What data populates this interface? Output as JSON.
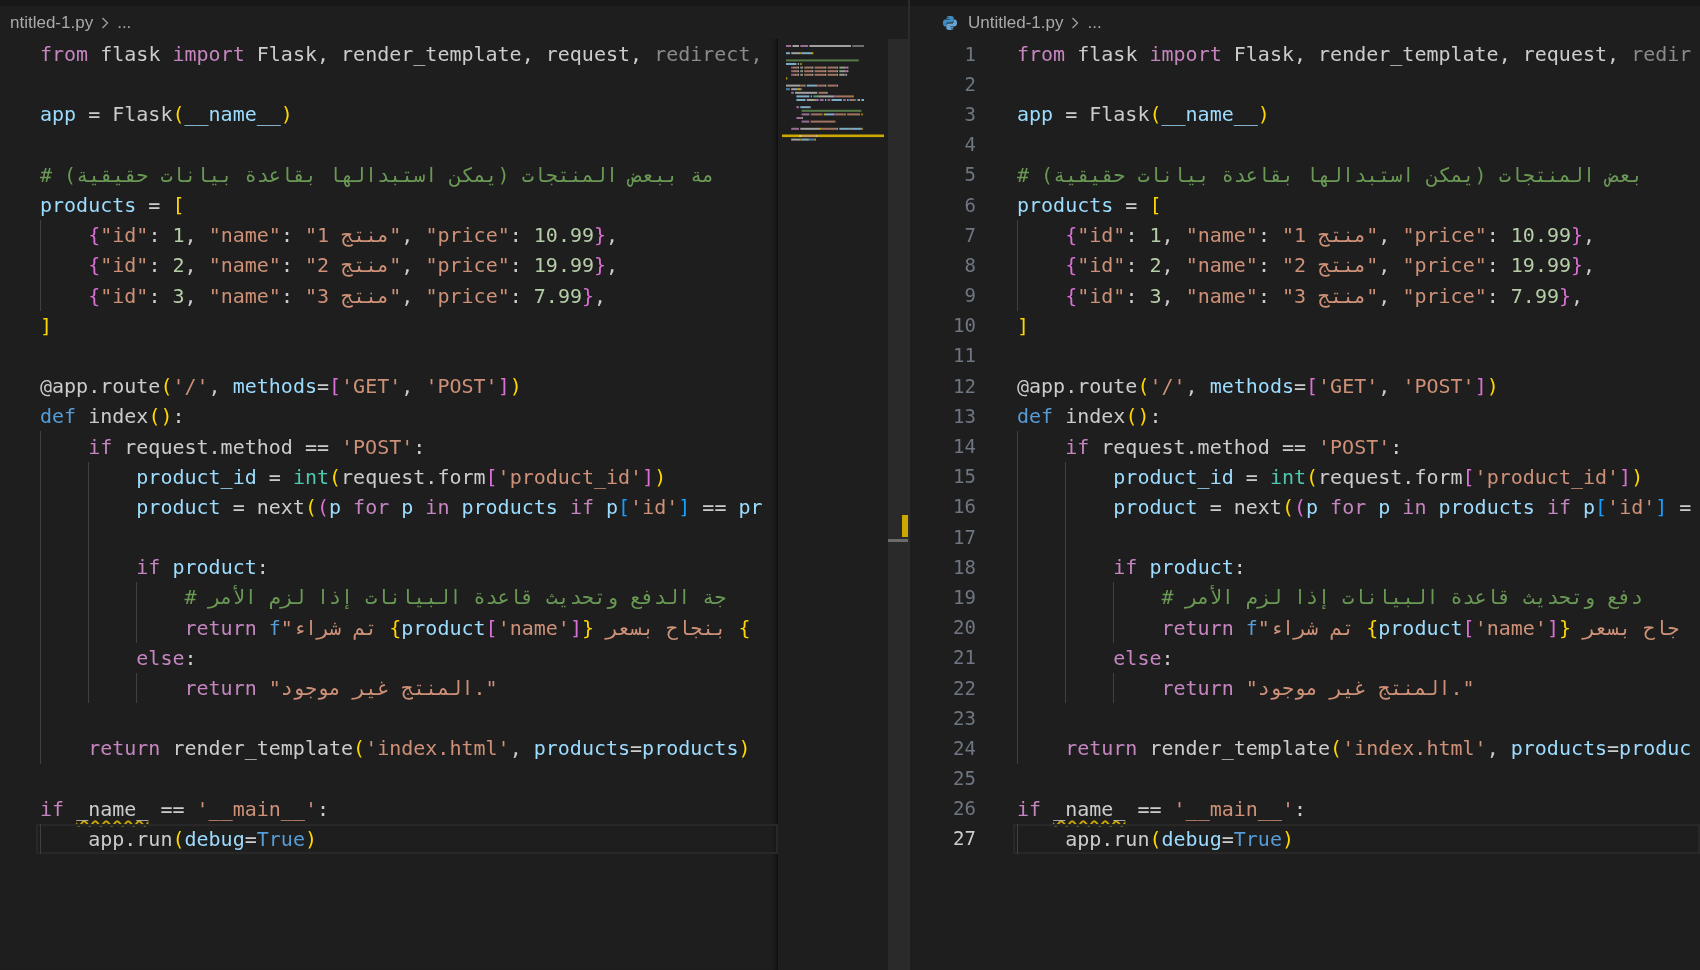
{
  "panes": [
    {
      "breadcrumb": {
        "file": "ntitled-1.py",
        "ellipsis": "..."
      },
      "lines": [
        {
          "current": false,
          "tokens": [
            {
              "text": "from",
              "kind": "kw"
            },
            {
              "text": " flask ",
              "kind": "txt"
            },
            {
              "text": "import",
              "kind": "kw"
            },
            {
              "text": " Flask, render_template, request, ",
              "kind": "txt"
            },
            {
              "text": "redirect,",
              "kind": "dim"
            }
          ]
        },
        {
          "current": false
        },
        {
          "current": false,
          "tokens": [
            {
              "text": "app",
              "kind": "var"
            },
            {
              "text": " = Flask",
              "kind": "txt"
            },
            {
              "text": "(",
              "kind": "b1"
            },
            {
              "text": "__name__",
              "kind": "var"
            },
            {
              "text": ")",
              "kind": "b1"
            }
          ]
        },
        {
          "current": false
        },
        {
          "current": false,
          "tokens": [
            {
              "text": "# مة ببعض المنتجات (يمكن استبدالها بقاعدة بيانات حقيقية)",
              "kind": "com"
            }
          ]
        },
        {
          "current": false,
          "tokens": [
            {
              "text": "products",
              "kind": "var"
            },
            {
              "text": " = ",
              "kind": "txt"
            },
            {
              "text": "[",
              "kind": "b1"
            }
          ]
        },
        {
          "current": false,
          "tokens": [
            {
              "text": "    {",
              "kind": "b2"
            },
            {
              "text": "\"id\"",
              "kind": "str"
            },
            {
              "text": ": ",
              "kind": "txt"
            },
            {
              "text": "1",
              "kind": "num"
            },
            {
              "text": ", ",
              "kind": "txt"
            },
            {
              "text": "\"name\"",
              "kind": "str"
            },
            {
              "text": ": ",
              "kind": "txt"
            },
            {
              "text": "\"منتج 1\"",
              "kind": "str"
            },
            {
              "text": ", ",
              "kind": "txt"
            },
            {
              "text": "\"price\"",
              "kind": "str"
            },
            {
              "text": ": ",
              "kind": "txt"
            },
            {
              "text": "10.99",
              "kind": "num"
            },
            {
              "text": "}",
              "kind": "b2"
            },
            {
              "text": ",",
              "kind": "txt"
            }
          ]
        },
        {
          "current": false,
          "tokens": [
            {
              "text": "    {",
              "kind": "b2"
            },
            {
              "text": "\"id\"",
              "kind": "str"
            },
            {
              "text": ": ",
              "kind": "txt"
            },
            {
              "text": "2",
              "kind": "num"
            },
            {
              "text": ", ",
              "kind": "txt"
            },
            {
              "text": "\"name\"",
              "kind": "str"
            },
            {
              "text": ": ",
              "kind": "txt"
            },
            {
              "text": "\"منتج 2\"",
              "kind": "str"
            },
            {
              "text": ", ",
              "kind": "txt"
            },
            {
              "text": "\"price\"",
              "kind": "str"
            },
            {
              "text": ": ",
              "kind": "txt"
            },
            {
              "text": "19.99",
              "kind": "num"
            },
            {
              "text": "}",
              "kind": "b2"
            },
            {
              "text": ",",
              "kind": "txt"
            }
          ]
        },
        {
          "current": false,
          "tokens": [
            {
              "text": "    {",
              "kind": "b2"
            },
            {
              "text": "\"id\"",
              "kind": "str"
            },
            {
              "text": ": ",
              "kind": "txt"
            },
            {
              "text": "3",
              "kind": "num"
            },
            {
              "text": ", ",
              "kind": "txt"
            },
            {
              "text": "\"name\"",
              "kind": "str"
            },
            {
              "text": ": ",
              "kind": "txt"
            },
            {
              "text": "\"منتج 3\"",
              "kind": "str"
            },
            {
              "text": ", ",
              "kind": "txt"
            },
            {
              "text": "\"price\"",
              "kind": "str"
            },
            {
              "text": ": ",
              "kind": "txt"
            },
            {
              "text": "7.99",
              "kind": "num"
            },
            {
              "text": "}",
              "kind": "b2"
            },
            {
              "text": ",",
              "kind": "txt"
            }
          ]
        },
        {
          "current": false,
          "tokens": [
            {
              "text": "]",
              "kind": "b1"
            }
          ]
        },
        {
          "current": false
        },
        {
          "current": false,
          "tokens": [
            {
              "text": "@app.route",
              "kind": "txt"
            },
            {
              "text": "(",
              "kind": "b1"
            },
            {
              "text": "'/'",
              "kind": "str"
            },
            {
              "text": ", ",
              "kind": "txt"
            },
            {
              "text": "methods",
              "kind": "var"
            },
            {
              "text": "=",
              "kind": "txt"
            },
            {
              "text": "[",
              "kind": "b2"
            },
            {
              "text": "'GET'",
              "kind": "str"
            },
            {
              "text": ", ",
              "kind": "txt"
            },
            {
              "text": "'POST'",
              "kind": "str"
            },
            {
              "text": "]",
              "kind": "b2"
            },
            {
              "text": ")",
              "kind": "b1"
            }
          ]
        },
        {
          "current": false,
          "tokens": [
            {
              "text": "def",
              "kind": "def"
            },
            {
              "text": " index",
              "kind": "txt"
            },
            {
              "text": "()",
              "kind": "b1"
            },
            {
              "text": ":",
              "kind": "txt"
            }
          ]
        },
        {
          "current": false,
          "tokens": [
            {
              "text": "    if",
              "kind": "kw"
            },
            {
              "text": " request.method == ",
              "kind": "txt"
            },
            {
              "text": "'POST'",
              "kind": "str"
            },
            {
              "text": ":",
              "kind": "txt"
            }
          ]
        },
        {
          "current": false,
          "tokens": [
            {
              "text": "        product_id",
              "kind": "var"
            },
            {
              "text": " = ",
              "kind": "txt"
            },
            {
              "text": "int",
              "kind": "type"
            },
            {
              "text": "(",
              "kind": "b1"
            },
            {
              "text": "request.form",
              "kind": "txt"
            },
            {
              "text": "[",
              "kind": "b2"
            },
            {
              "text": "'product_id'",
              "kind": "str"
            },
            {
              "text": "]",
              "kind": "b2"
            },
            {
              "text": ")",
              "kind": "b1"
            }
          ]
        },
        {
          "current": false,
          "tokens": [
            {
              "text": "        product",
              "kind": "var"
            },
            {
              "text": " = next",
              "kind": "txt"
            },
            {
              "text": "(",
              "kind": "b1"
            },
            {
              "text": "(",
              "kind": "b2"
            },
            {
              "text": "p ",
              "kind": "var"
            },
            {
              "text": "for",
              "kind": "kw"
            },
            {
              "text": " p ",
              "kind": "var"
            },
            {
              "text": "in",
              "kind": "kw"
            },
            {
              "text": " products ",
              "kind": "var"
            },
            {
              "text": "if",
              "kind": "kw"
            },
            {
              "text": " p",
              "kind": "var"
            },
            {
              "text": "[",
              "kind": "b3"
            },
            {
              "text": "'id'",
              "kind": "str"
            },
            {
              "text": "]",
              "kind": "b3"
            },
            {
              "text": " == ",
              "kind": "txt"
            },
            {
              "text": "pr",
              "kind": "var"
            }
          ]
        },
        {
          "current": false
        },
        {
          "current": false,
          "tokens": [
            {
              "text": "        if",
              "kind": "kw"
            },
            {
              "text": " product",
              "kind": "var"
            },
            {
              "text": ":",
              "kind": "txt"
            }
          ]
        },
        {
          "current": false,
          "tokens": [
            {
              "text": "            # جة الدفع وتحديث قاعدة البيانات إذا لزم الأمر",
              "kind": "com"
            }
          ]
        },
        {
          "current": false,
          "tokens": [
            {
              "text": "            return",
              "kind": "kw"
            },
            {
              "text": " f",
              "kind": "def"
            },
            {
              "text": "\"تم شراء ",
              "kind": "str"
            },
            {
              "text": "{",
              "kind": "b1"
            },
            {
              "text": "product",
              "kind": "var"
            },
            {
              "text": "[",
              "kind": "b2"
            },
            {
              "text": "'name'",
              "kind": "str"
            },
            {
              "text": "]",
              "kind": "b2"
            },
            {
              "text": "}",
              "kind": "b1"
            },
            {
              "text": " بنجاح بسعر ",
              "kind": "str"
            },
            {
              "text": "{",
              "kind": "b1"
            }
          ]
        },
        {
          "current": false,
          "tokens": [
            {
              "text": "        else",
              "kind": "kw"
            },
            {
              "text": ":",
              "kind": "txt"
            }
          ]
        },
        {
          "current": false,
          "tokens": [
            {
              "text": "            return ",
              "kind": "kw"
            },
            {
              "text": "\"المنتج غير موجود.\"",
              "kind": "str"
            }
          ]
        },
        {
          "current": false
        },
        {
          "current": false,
          "tokens": [
            {
              "text": "    return",
              "kind": "kw"
            },
            {
              "text": " render_template",
              "kind": "txt"
            },
            {
              "text": "(",
              "kind": "b1"
            },
            {
              "text": "'index.html'",
              "kind": "str"
            },
            {
              "text": ", ",
              "kind": "txt"
            },
            {
              "text": "products",
              "kind": "var"
            },
            {
              "text": "=",
              "kind": "txt"
            },
            {
              "text": "products",
              "kind": "var"
            },
            {
              "text": ")",
              "kind": "b1"
            }
          ]
        },
        {
          "current": false
        },
        {
          "current": false,
          "tokens": [
            {
              "text": "if ",
              "kind": "kw"
            },
            {
              "text": "_name_",
              "kind": "warn"
            },
            {
              "text": " == ",
              "kind": "txt"
            },
            {
              "text": "'__main__'",
              "kind": "str"
            },
            {
              "text": ":",
              "kind": "txt"
            }
          ]
        },
        {
          "current": true,
          "tokens": [
            {
              "text": "    app.run",
              "kind": "txt"
            },
            {
              "text": "(",
              "kind": "b1"
            },
            {
              "text": "debug",
              "kind": "var"
            },
            {
              "text": "=",
              "kind": "txt"
            },
            {
              "text": "True",
              "kind": "def"
            },
            {
              "text": ")",
              "kind": "b1"
            }
          ]
        }
      ]
    },
    {
      "breadcrumb": {
        "file_icon": true,
        "file": "Untitled-1.py",
        "ellipsis": "..."
      },
      "lines": [
        {
          "number": "1",
          "current": false,
          "tokens": [
            {
              "text": "from",
              "kind": "kw"
            },
            {
              "text": " flask ",
              "kind": "txt"
            },
            {
              "text": "import",
              "kind": "kw"
            },
            {
              "text": " Flask, render_template, request, ",
              "kind": "txt"
            },
            {
              "text": "redir",
              "kind": "dim"
            }
          ]
        },
        {
          "number": "2",
          "current": false
        },
        {
          "number": "3",
          "current": false,
          "tokens": [
            {
              "text": "app",
              "kind": "var"
            },
            {
              "text": " = Flask",
              "kind": "txt"
            },
            {
              "text": "(",
              "kind": "b1"
            },
            {
              "text": "__name__",
              "kind": "var"
            },
            {
              "text": ")",
              "kind": "b1"
            }
          ]
        },
        {
          "number": "4",
          "current": false
        },
        {
          "number": "5",
          "current": false,
          "tokens": [
            {
              "text": "# بعض المنتجات (يمكن استبدالها بقاعدة بيانات حقيقية)",
              "kind": "com"
            }
          ]
        },
        {
          "number": "6",
          "current": false,
          "tokens": [
            {
              "text": "products",
              "kind": "var"
            },
            {
              "text": " = ",
              "kind": "txt"
            },
            {
              "text": "[",
              "kind": "b1"
            }
          ]
        },
        {
          "number": "7",
          "current": false,
          "tokens": [
            {
              "text": "    {",
              "kind": "b2"
            },
            {
              "text": "\"id\"",
              "kind": "str"
            },
            {
              "text": ": ",
              "kind": "txt"
            },
            {
              "text": "1",
              "kind": "num"
            },
            {
              "text": ", ",
              "kind": "txt"
            },
            {
              "text": "\"name\"",
              "kind": "str"
            },
            {
              "text": ": ",
              "kind": "txt"
            },
            {
              "text": "\"منتج 1\"",
              "kind": "str"
            },
            {
              "text": ", ",
              "kind": "txt"
            },
            {
              "text": "\"price\"",
              "kind": "str"
            },
            {
              "text": ": ",
              "kind": "txt"
            },
            {
              "text": "10.99",
              "kind": "num"
            },
            {
              "text": "}",
              "kind": "b2"
            },
            {
              "text": ",",
              "kind": "txt"
            }
          ]
        },
        {
          "number": "8",
          "current": false,
          "tokens": [
            {
              "text": "    {",
              "kind": "b2"
            },
            {
              "text": "\"id\"",
              "kind": "str"
            },
            {
              "text": ": ",
              "kind": "txt"
            },
            {
              "text": "2",
              "kind": "num"
            },
            {
              "text": ", ",
              "kind": "txt"
            },
            {
              "text": "\"name\"",
              "kind": "str"
            },
            {
              "text": ": ",
              "kind": "txt"
            },
            {
              "text": "\"منتج 2\"",
              "kind": "str"
            },
            {
              "text": ", ",
              "kind": "txt"
            },
            {
              "text": "\"price\"",
              "kind": "str"
            },
            {
              "text": ": ",
              "kind": "txt"
            },
            {
              "text": "19.99",
              "kind": "num"
            },
            {
              "text": "}",
              "kind": "b2"
            },
            {
              "text": ",",
              "kind": "txt"
            }
          ]
        },
        {
          "number": "9",
          "current": false,
          "tokens": [
            {
              "text": "    {",
              "kind": "b2"
            },
            {
              "text": "\"id\"",
              "kind": "str"
            },
            {
              "text": ": ",
              "kind": "txt"
            },
            {
              "text": "3",
              "kind": "num"
            },
            {
              "text": ", ",
              "kind": "txt"
            },
            {
              "text": "\"name\"",
              "kind": "str"
            },
            {
              "text": ": ",
              "kind": "txt"
            },
            {
              "text": "\"منتج 3\"",
              "kind": "str"
            },
            {
              "text": ", ",
              "kind": "txt"
            },
            {
              "text": "\"price\"",
              "kind": "str"
            },
            {
              "text": ": ",
              "kind": "txt"
            },
            {
              "text": "7.99",
              "kind": "num"
            },
            {
              "text": "}",
              "kind": "b2"
            },
            {
              "text": ",",
              "kind": "txt"
            }
          ]
        },
        {
          "number": "10",
          "current": false,
          "tokens": [
            {
              "text": "]",
              "kind": "b1"
            }
          ]
        },
        {
          "number": "11",
          "current": false
        },
        {
          "number": "12",
          "current": false,
          "tokens": [
            {
              "text": "@app.route",
              "kind": "txt"
            },
            {
              "text": "(",
              "kind": "b1"
            },
            {
              "text": "'/'",
              "kind": "str"
            },
            {
              "text": ", ",
              "kind": "txt"
            },
            {
              "text": "methods",
              "kind": "var"
            },
            {
              "text": "=",
              "kind": "txt"
            },
            {
              "text": "[",
              "kind": "b2"
            },
            {
              "text": "'GET'",
              "kind": "str"
            },
            {
              "text": ", ",
              "kind": "txt"
            },
            {
              "text": "'POST'",
              "kind": "str"
            },
            {
              "text": "]",
              "kind": "b2"
            },
            {
              "text": ")",
              "kind": "b1"
            }
          ]
        },
        {
          "number": "13",
          "current": false,
          "tokens": [
            {
              "text": "def",
              "kind": "def"
            },
            {
              "text": " index",
              "kind": "txt"
            },
            {
              "text": "()",
              "kind": "b1"
            },
            {
              "text": ":",
              "kind": "txt"
            }
          ]
        },
        {
          "number": "14",
          "current": false,
          "tokens": [
            {
              "text": "    if",
              "kind": "kw"
            },
            {
              "text": " request.method == ",
              "kind": "txt"
            },
            {
              "text": "'POST'",
              "kind": "str"
            },
            {
              "text": ":",
              "kind": "txt"
            }
          ]
        },
        {
          "number": "15",
          "current": false,
          "tokens": [
            {
              "text": "        product_id",
              "kind": "var"
            },
            {
              "text": " = ",
              "kind": "txt"
            },
            {
              "text": "int",
              "kind": "type"
            },
            {
              "text": "(",
              "kind": "b1"
            },
            {
              "text": "request.form",
              "kind": "txt"
            },
            {
              "text": "[",
              "kind": "b2"
            },
            {
              "text": "'product_id'",
              "kind": "str"
            },
            {
              "text": "]",
              "kind": "b2"
            },
            {
              "text": ")",
              "kind": "b1"
            }
          ]
        },
        {
          "number": "16",
          "current": false,
          "tokens": [
            {
              "text": "        product",
              "kind": "var"
            },
            {
              "text": " = next",
              "kind": "txt"
            },
            {
              "text": "(",
              "kind": "b1"
            },
            {
              "text": "(",
              "kind": "b2"
            },
            {
              "text": "p ",
              "kind": "var"
            },
            {
              "text": "for",
              "kind": "kw"
            },
            {
              "text": " p ",
              "kind": "var"
            },
            {
              "text": "in",
              "kind": "kw"
            },
            {
              "text": " products ",
              "kind": "var"
            },
            {
              "text": "if",
              "kind": "kw"
            },
            {
              "text": " p",
              "kind": "var"
            },
            {
              "text": "[",
              "kind": "b3"
            },
            {
              "text": "'id'",
              "kind": "str"
            },
            {
              "text": "]",
              "kind": "b3"
            },
            {
              "text": " =",
              "kind": "txt"
            }
          ]
        },
        {
          "number": "17",
          "current": false
        },
        {
          "number": "18",
          "current": false,
          "tokens": [
            {
              "text": "        if",
              "kind": "kw"
            },
            {
              "text": " product",
              "kind": "var"
            },
            {
              "text": ":",
              "kind": "txt"
            }
          ]
        },
        {
          "number": "19",
          "current": false,
          "tokens": [
            {
              "text": "            # دفع وتحديث قاعدة البيانات إذا لزم الأمر",
              "kind": "com"
            }
          ]
        },
        {
          "number": "20",
          "current": false,
          "tokens": [
            {
              "text": "            return",
              "kind": "kw"
            },
            {
              "text": " f",
              "kind": "def"
            },
            {
              "text": "\"تم شراء ",
              "kind": "str"
            },
            {
              "text": "{",
              "kind": "b1"
            },
            {
              "text": "product",
              "kind": "var"
            },
            {
              "text": "[",
              "kind": "b2"
            },
            {
              "text": "'name'",
              "kind": "str"
            },
            {
              "text": "]",
              "kind": "b2"
            },
            {
              "text": "}",
              "kind": "b1"
            },
            {
              "text": " جاح بسعر",
              "kind": "str"
            }
          ]
        },
        {
          "number": "21",
          "current": false,
          "tokens": [
            {
              "text": "        else",
              "kind": "kw"
            },
            {
              "text": ":",
              "kind": "txt"
            }
          ]
        },
        {
          "number": "22",
          "current": false,
          "tokens": [
            {
              "text": "            return ",
              "kind": "kw"
            },
            {
              "text": "\"المنتج غير موجود.\"",
              "kind": "str"
            }
          ]
        },
        {
          "number": "23",
          "current": false
        },
        {
          "number": "24",
          "current": false,
          "tokens": [
            {
              "text": "    return",
              "kind": "kw"
            },
            {
              "text": " render_template",
              "kind": "txt"
            },
            {
              "text": "(",
              "kind": "b1"
            },
            {
              "text": "'index.html'",
              "kind": "str"
            },
            {
              "text": ", ",
              "kind": "txt"
            },
            {
              "text": "products",
              "kind": "var"
            },
            {
              "text": "=",
              "kind": "txt"
            },
            {
              "text": "produc",
              "kind": "var"
            }
          ]
        },
        {
          "number": "25",
          "current": false
        },
        {
          "number": "26",
          "current": false,
          "tokens": [
            {
              "text": "if ",
              "kind": "kw"
            },
            {
              "text": "_name_",
              "kind": "warn"
            },
            {
              "text": " == ",
              "kind": "txt"
            },
            {
              "text": "'__main__'",
              "kind": "str"
            },
            {
              "text": ":",
              "kind": "txt"
            }
          ]
        },
        {
          "number": "27",
          "current": true,
          "tokens": [
            {
              "text": "    app.run",
              "kind": "txt"
            },
            {
              "text": "(",
              "kind": "b1"
            },
            {
              "text": "debug",
              "kind": "var"
            },
            {
              "text": "=",
              "kind": "txt"
            },
            {
              "text": "True",
              "kind": "def"
            },
            {
              "text": ")",
              "kind": "b1"
            }
          ]
        }
      ]
    }
  ]
}
